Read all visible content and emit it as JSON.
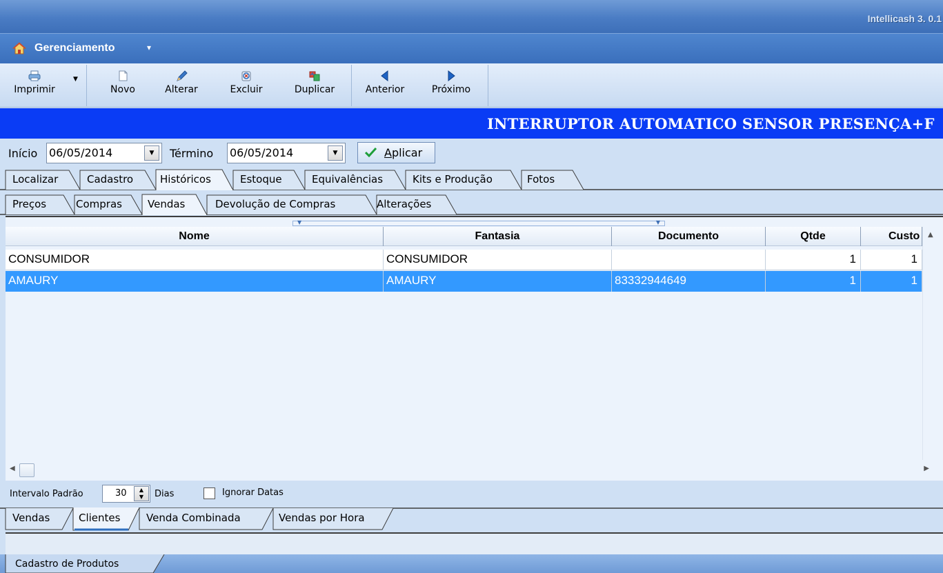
{
  "app": {
    "title": "Intellicash 3. 0.1"
  },
  "menu": {
    "label": "Gerenciamento",
    "icon": "home-icon"
  },
  "toolbar": {
    "buttons": [
      {
        "label": "Imprimir",
        "icon": "printer-icon"
      },
      {
        "label": "Novo",
        "icon": "new-document-icon"
      },
      {
        "label": "Alterar",
        "icon": "pencil-icon"
      },
      {
        "label": "Excluir",
        "icon": "delete-icon"
      },
      {
        "label": "Duplicar",
        "icon": "duplicate-icon"
      },
      {
        "label": "Anterior",
        "icon": "arrow-left-icon"
      },
      {
        "label": "Próximo",
        "icon": "arrow-right-icon"
      }
    ]
  },
  "product": {
    "title": "INTERRUPTOR AUTOMATICO SENSOR PRESENÇA+F"
  },
  "filter": {
    "inicio_label": "Início",
    "inicio_value": "06/05/2014",
    "termino_label": "Término",
    "termino_value": "06/05/2014",
    "apply_label_prefix": "",
    "apply_label_underlined": "A",
    "apply_label_rest": "plicar"
  },
  "main_tabs": [
    {
      "label": "Localizar"
    },
    {
      "label": "Cadastro"
    },
    {
      "label": "Históricos",
      "active": true
    },
    {
      "label": "Estoque"
    },
    {
      "label": "Equivalências"
    },
    {
      "label": "Kits e Produção"
    },
    {
      "label": "Fotos"
    }
  ],
  "sub_tabs": [
    {
      "label": "Preços"
    },
    {
      "label": "Compras"
    },
    {
      "label": "Vendas",
      "active": true
    },
    {
      "label": "Devolução de Compras"
    },
    {
      "label": "Alterações"
    }
  ],
  "grid": {
    "columns": [
      "Nome",
      "Fantasia",
      "Documento",
      "Qtde",
      "Custo"
    ],
    "rows": [
      {
        "nome": "CONSUMIDOR",
        "fantasia": "CONSUMIDOR",
        "documento": "",
        "qtde": "1",
        "custo": "1"
      },
      {
        "nome": "AMAURY",
        "fantasia": "AMAURY",
        "documento": "83332944649",
        "qtde": "1",
        "custo": "1",
        "selected": true
      }
    ]
  },
  "interval": {
    "label": "Intervalo Padrão",
    "value": "30",
    "unit": "Dias",
    "ignore_label": "Ignorar Datas",
    "ignore_checked": false
  },
  "bottom_tabs": [
    {
      "label": "Vendas"
    },
    {
      "label": "Clientes",
      "active": true
    },
    {
      "label": "Venda Combinada"
    },
    {
      "label": "Vendas por Hora"
    }
  ],
  "status": {
    "tab_label": "Cadastro de Produtos"
  },
  "colors": {
    "banner": "#0a3cf5",
    "selection": "#3399ff",
    "title_bar": "#4a7cc4"
  }
}
